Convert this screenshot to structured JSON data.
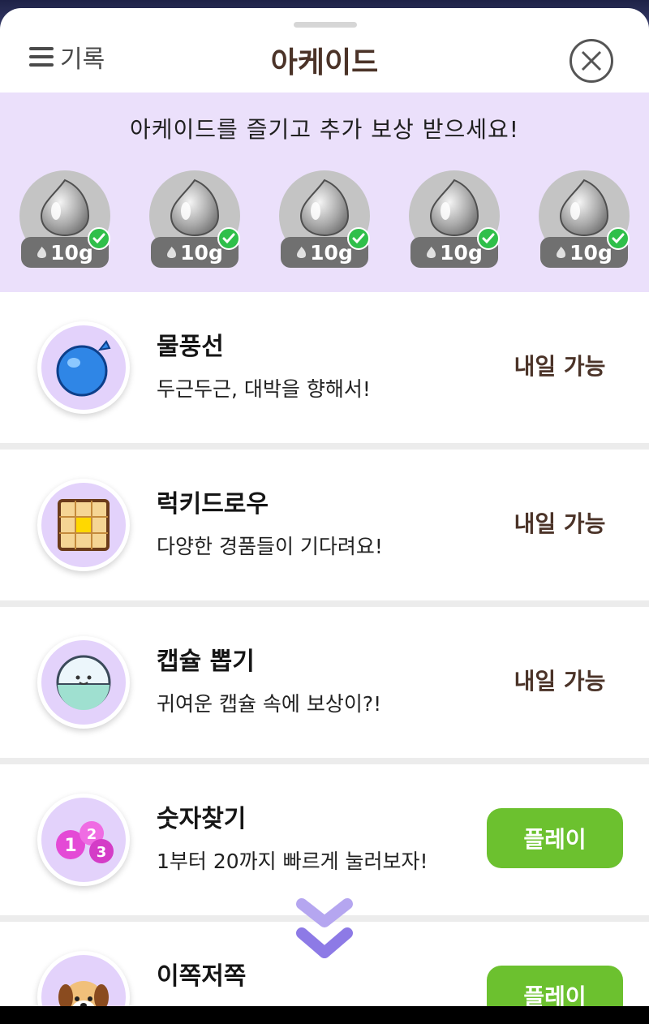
{
  "header": {
    "history_label": "기록",
    "title": "아케이드"
  },
  "banner": {
    "text": "아케이드를 즐기고 추가 보상 받으세요!",
    "rewards": [
      {
        "amount": "10g",
        "claimed": true
      },
      {
        "amount": "10g",
        "claimed": true
      },
      {
        "amount": "10g",
        "claimed": true
      },
      {
        "amount": "10g",
        "claimed": true
      },
      {
        "amount": "10g",
        "claimed": true
      }
    ]
  },
  "games": [
    {
      "name": "물풍선",
      "desc": "두근두근, 대박을 향해서!",
      "status": "내일 가능",
      "icon": "water-balloon-icon"
    },
    {
      "name": "럭키드로우",
      "desc": "다양한 경품들이 기다려요!",
      "status": "내일 가능",
      "icon": "lucky-draw-grid-icon"
    },
    {
      "name": "캡슐 뽑기",
      "desc": "귀여운 캡슐 속에 보상이?!",
      "status": "내일 가능",
      "icon": "capsule-icon"
    },
    {
      "name": "숫자찾기",
      "desc": "1부터 20까지 빠르게 눌러보자!",
      "status": "플레이",
      "icon": "number-balls-icon"
    },
    {
      "name": "이쪽저쪽",
      "desc": "",
      "status": "플레이",
      "icon": "puppy-icon"
    }
  ],
  "colors": {
    "banner_bg": "#ebe0fb",
    "play_button": "#6cc12f",
    "status_text": "#4b3328"
  }
}
